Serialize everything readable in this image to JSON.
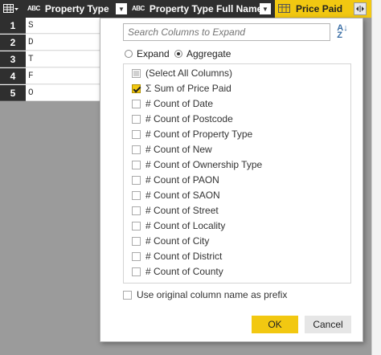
{
  "header": {
    "col1_label": "Property Type",
    "col2_label": "Property Type Full Name",
    "col3_label": "Price Paid",
    "abc_glyph": "ABC"
  },
  "rows": [
    {
      "num": "1",
      "value": "S"
    },
    {
      "num": "2",
      "value": "D"
    },
    {
      "num": "3",
      "value": "T"
    },
    {
      "num": "4",
      "value": "F"
    },
    {
      "num": "5",
      "value": "O"
    }
  ],
  "dialog": {
    "search_placeholder": "Search Columns to Expand",
    "mode_expand": "Expand",
    "mode_aggregate": "Aggregate",
    "selected_mode": "Aggregate",
    "items": [
      {
        "label": "(Select All Columns)",
        "state": "partial"
      },
      {
        "label": "Σ Sum of Price Paid",
        "state": "checked"
      },
      {
        "label": "# Count of Date",
        "state": "unchecked"
      },
      {
        "label": "# Count of Postcode",
        "state": "unchecked"
      },
      {
        "label": "# Count of Property Type",
        "state": "unchecked"
      },
      {
        "label": "# Count of New",
        "state": "unchecked"
      },
      {
        "label": "# Count of Ownership Type",
        "state": "unchecked"
      },
      {
        "label": "# Count of PAON",
        "state": "unchecked"
      },
      {
        "label": "# Count of SAON",
        "state": "unchecked"
      },
      {
        "label": "# Count of Street",
        "state": "unchecked"
      },
      {
        "label": "# Count of Locality",
        "state": "unchecked"
      },
      {
        "label": "# Count of City",
        "state": "unchecked"
      },
      {
        "label": "# Count of District",
        "state": "unchecked"
      },
      {
        "label": "# Count of County",
        "state": "unchecked"
      }
    ],
    "prefix_label": "Use original column name as prefix",
    "prefix_checked": false,
    "ok_label": "OK",
    "cancel_label": "Cancel"
  },
  "colors": {
    "accent": "#f2c811",
    "header_bg": "#2f2f2f",
    "grid_gray": "#9b9b9b"
  },
  "icons": {
    "table_menu": "table-icon",
    "dropdown": "chevron-down-icon",
    "expand": "expand-column-icon",
    "sort": "sort-az-icon"
  }
}
